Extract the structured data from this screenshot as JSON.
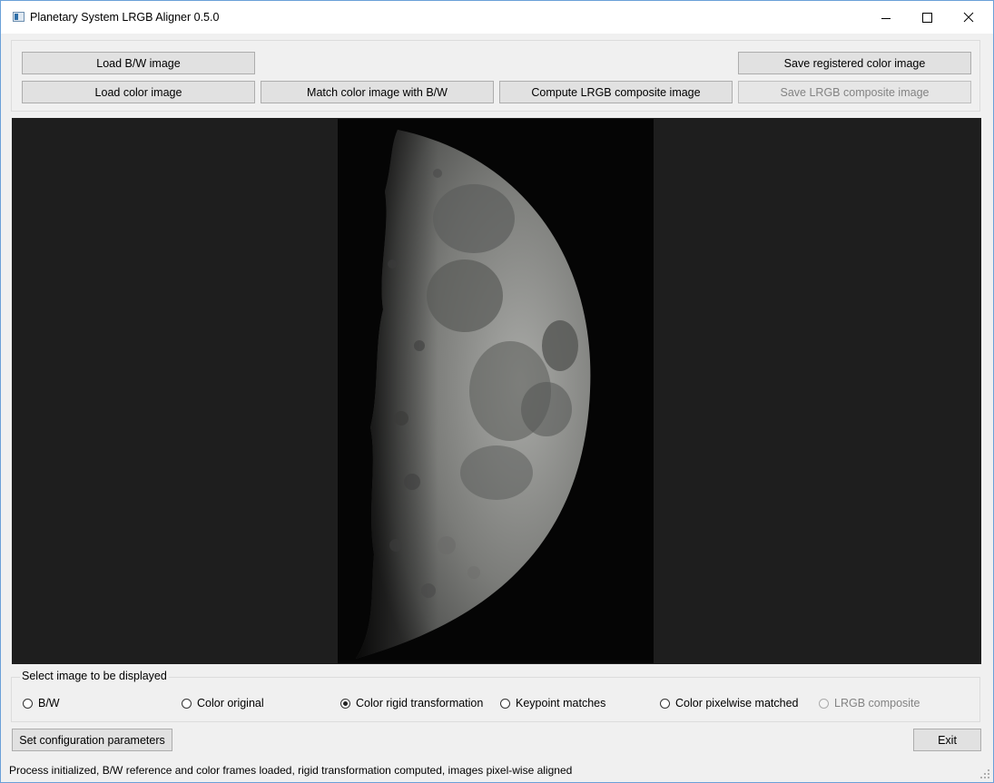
{
  "window": {
    "title": "Planetary System LRGB Aligner 0.5.0"
  },
  "toolbar": {
    "load_bw": "Load B/W image",
    "load_color": "Load color image",
    "match": "Match color image with B/W",
    "compute": "Compute LRGB composite image",
    "save_registered": "Save registered color image",
    "save_lrgb": "Save LRGB composite image"
  },
  "display": {
    "group_title": "Select image to be displayed",
    "options": [
      {
        "label": "B/W",
        "checked": false,
        "enabled": true
      },
      {
        "label": "Color original",
        "checked": false,
        "enabled": true
      },
      {
        "label": "Color rigid transformation",
        "checked": true,
        "enabled": true
      },
      {
        "label": "Keypoint matches",
        "checked": false,
        "enabled": true
      },
      {
        "label": "Color pixelwise matched",
        "checked": false,
        "enabled": true
      },
      {
        "label": "LRGB composite",
        "checked": false,
        "enabled": false
      }
    ]
  },
  "footer": {
    "config": "Set configuration parameters",
    "exit": "Exit",
    "status": "Process initialized, B/W reference and color frames loaded, rigid transformation computed, images pixel-wise aligned"
  },
  "colors": {
    "viewer_bg": "#1e1e1e",
    "window_bg": "#f0f0f0",
    "border_accent": "#6aa0d8"
  }
}
